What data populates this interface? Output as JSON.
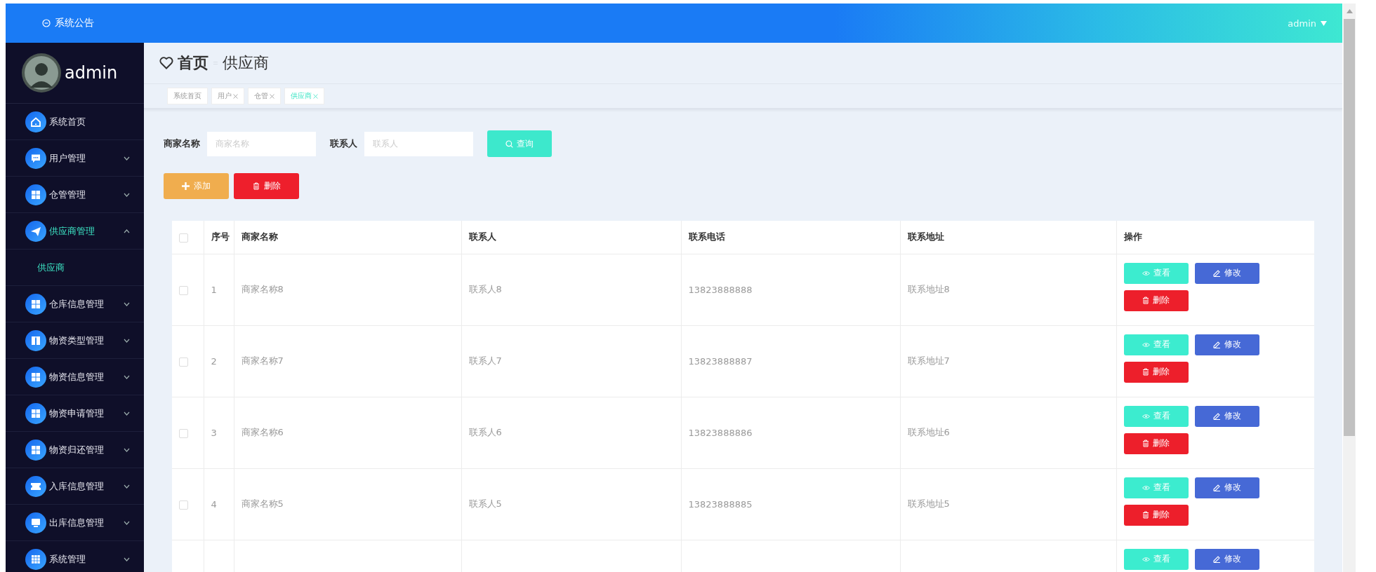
{
  "top_bar": {
    "notice": "系统公告",
    "user": "admin"
  },
  "sidebar": {
    "user_name": "admin",
    "items": [
      {
        "label": "系统首页",
        "selected": false
      },
      {
        "label": "用户管理",
        "selected": false,
        "expanded": false
      },
      {
        "label": "仓管管理",
        "selected": false,
        "expanded": false
      },
      {
        "label": "供应商管理",
        "selected": true,
        "expanded": true,
        "children": [
          {
            "label": "供应商",
            "selected": true
          }
        ]
      },
      {
        "label": "仓库信息管理",
        "selected": false,
        "expanded": false
      },
      {
        "label": "物资类型管理",
        "selected": false,
        "expanded": false
      },
      {
        "label": "物资信息管理",
        "selected": false,
        "expanded": false
      },
      {
        "label": "物资申请管理",
        "selected": false,
        "expanded": false
      },
      {
        "label": "物资归还管理",
        "selected": false,
        "expanded": false
      },
      {
        "label": "入库信息管理",
        "selected": false,
        "expanded": false
      },
      {
        "label": "出库信息管理",
        "selected": false,
        "expanded": false
      },
      {
        "label": "系统管理",
        "selected": false,
        "expanded": false
      }
    ]
  },
  "breadcrumb": {
    "home": "首页",
    "current": "供应商"
  },
  "tags": [
    {
      "label": "系统首页",
      "closable": false,
      "selected": false
    },
    {
      "label": "用户",
      "closable": true,
      "selected": false
    },
    {
      "label": "仓管",
      "closable": true,
      "selected": false
    },
    {
      "label": "供应商",
      "closable": true,
      "selected": true
    }
  ],
  "search": {
    "fields": [
      {
        "label": "商家名称",
        "placeholder": "商家名称"
      },
      {
        "label": "联系人",
        "placeholder": "联系人"
      }
    ],
    "button": "查询"
  },
  "toolbar": [
    {
      "kind": "add",
      "label": "添加"
    },
    {
      "kind": "delete",
      "label": "删除"
    }
  ],
  "table": {
    "select_all_checked": false,
    "columns": [
      "序号",
      "商家名称",
      "联系人",
      "联系电话",
      "联系地址",
      "操作"
    ],
    "rows": [
      {
        "checked": false,
        "cells": [
          "1",
          "商家名称8",
          "联系人8",
          "13823888888",
          "联系地址8"
        ],
        "actions": [
          {
            "kind": "view",
            "label": "查看"
          },
          {
            "kind": "edit",
            "label": "修改"
          },
          {
            "kind": "delete",
            "label": "删除"
          }
        ]
      },
      {
        "checked": false,
        "cells": [
          "2",
          "商家名称7",
          "联系人7",
          "13823888887",
          "联系地址7"
        ],
        "actions": [
          {
            "kind": "view",
            "label": "查看"
          },
          {
            "kind": "edit",
            "label": "修改"
          },
          {
            "kind": "delete",
            "label": "删除"
          }
        ]
      },
      {
        "checked": false,
        "cells": [
          "3",
          "商家名称6",
          "联系人6",
          "13823888886",
          "联系地址6"
        ],
        "actions": [
          {
            "kind": "view",
            "label": "查看"
          },
          {
            "kind": "edit",
            "label": "修改"
          },
          {
            "kind": "delete",
            "label": "删除"
          }
        ]
      },
      {
        "checked": false,
        "cells": [
          "4",
          "商家名称5",
          "联系人5",
          "13823888885",
          "联系地址5"
        ],
        "actions": [
          {
            "kind": "view",
            "label": "查看"
          },
          {
            "kind": "edit",
            "label": "修改"
          },
          {
            "kind": "delete",
            "label": "删除"
          }
        ]
      },
      {
        "actions": [
          {
            "kind": "view",
            "label": "查看"
          },
          {
            "kind": "edit",
            "label": "修改"
          }
        ]
      }
    ]
  }
}
